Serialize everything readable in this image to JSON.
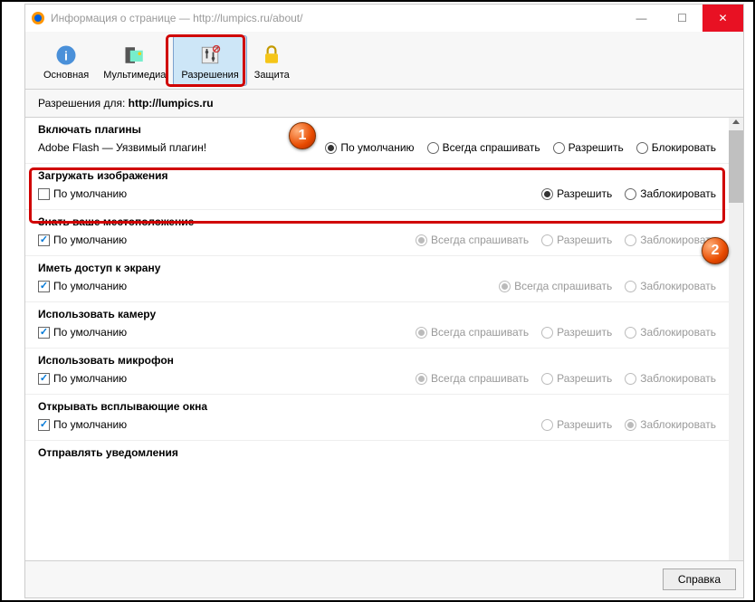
{
  "window": {
    "title": "Информация о странице — http://lumpics.ru/about/"
  },
  "toolbar": {
    "items": [
      {
        "label": "Основная"
      },
      {
        "label": "Мультимедиа"
      },
      {
        "label": "Разрешения"
      },
      {
        "label": "Защита"
      }
    ]
  },
  "perm_header": {
    "prefix": "Разрешения для:  ",
    "url": "http://lumpics.ru"
  },
  "sections": {
    "plugins": {
      "title": "Включать плагины",
      "subtext": "Adobe Flash — Уязвимый плагин!",
      "opts": [
        "По умолчанию",
        "Всегда спрашивать",
        "Разрешить",
        "Блокировать"
      ]
    },
    "images": {
      "title": "Загружать изображения",
      "default_label": "По умолчанию",
      "opts": [
        "Разрешить",
        "Заблокировать"
      ]
    },
    "location": {
      "title": "Знать ваше местоположение",
      "default_label": "По умолчанию",
      "opts": [
        "Всегда спрашивать",
        "Разрешить",
        "Заблокировать"
      ]
    },
    "screen": {
      "title": "Иметь доступ к экрану",
      "default_label": "По умолчанию",
      "opts": [
        "Всегда спрашивать",
        "Заблокировать"
      ]
    },
    "camera": {
      "title": "Использовать камеру",
      "default_label": "По умолчанию",
      "opts": [
        "Всегда спрашивать",
        "Разрешить",
        "Заблокировать"
      ]
    },
    "microphone": {
      "title": "Использовать микрофон",
      "default_label": "По умолчанию",
      "opts": [
        "Всегда спрашивать",
        "Разрешить",
        "Заблокировать"
      ]
    },
    "popups": {
      "title": "Открывать всплывающие окна",
      "default_label": "По умолчанию",
      "opts": [
        "Разрешить",
        "Заблокировать"
      ]
    },
    "notifications": {
      "title": "Отправлять уведомления"
    }
  },
  "footer": {
    "help": "Справка"
  },
  "badges": {
    "one": "1",
    "two": "2"
  }
}
